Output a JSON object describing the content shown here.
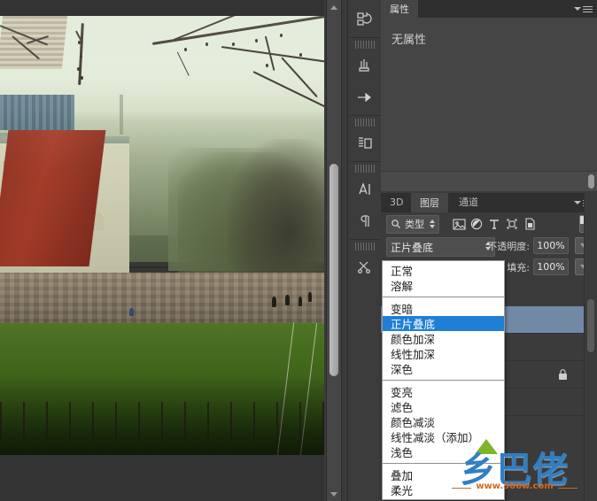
{
  "app": "Adobe Photoshop",
  "canvas": {
    "name": "document-canvas",
    "description": "Photo of a historic building with green tiled roof, bare tree branches, stone wall, stairs, green sports field and red running track"
  },
  "canvas_scrollbar": {
    "up_arrow": "scroll-up",
    "down_arrow": "scroll-down"
  },
  "tool_strip": {
    "items": [
      {
        "name": "history-actions-icon",
        "glyph": "history"
      },
      {
        "name": "brushes-icon",
        "glyph": "brush"
      },
      {
        "name": "tool-presets-icon",
        "glyph": "preset"
      },
      {
        "name": "clone-source-icon",
        "glyph": "clone"
      },
      {
        "name": "character-panel-icon",
        "glyph": "A"
      },
      {
        "name": "paragraph-panel-icon",
        "glyph": "pilcrow"
      },
      {
        "name": "adjustments-tools-icon",
        "glyph": "scissors"
      }
    ]
  },
  "properties_panel": {
    "tab_label": "属性",
    "empty_message": "无属性",
    "menu_icon": "panel-menu-icon"
  },
  "layers_panel": {
    "tabs": [
      {
        "label": "3D",
        "active": false
      },
      {
        "label": "图层",
        "active": true
      },
      {
        "label": "通道",
        "active": false
      }
    ],
    "menu_icon": "panel-menu-icon",
    "filter": {
      "search_icon": "search-icon",
      "kind_label": "类型",
      "icons": [
        {
          "name": "filter-pixel-icon"
        },
        {
          "name": "filter-adjustment-icon"
        },
        {
          "name": "filter-type-icon"
        },
        {
          "name": "filter-shape-icon"
        },
        {
          "name": "filter-smart-object-icon"
        }
      ],
      "toggle_name": "filter-enable-toggle"
    },
    "blend_mode_value": "正片叠底",
    "opacity_label": "不透明度:",
    "opacity_value": "100%",
    "fill_label": "填充:",
    "fill_value": "100%",
    "rows": [
      {
        "name": "layer-row-selected",
        "selected": true,
        "locked": false
      },
      {
        "name": "layer-row-2",
        "selected": false,
        "locked": false
      },
      {
        "name": "layer-row-background",
        "selected": false,
        "locked": true
      },
      {
        "name": "layer-row-4",
        "selected": false,
        "locked": false
      }
    ],
    "lock_icon": "lock-icon"
  },
  "blend_menu": {
    "name": "blend-mode-dropdown",
    "groups": [
      {
        "items": [
          {
            "label": "正常",
            "selected": false
          },
          {
            "label": "溶解",
            "selected": false
          }
        ]
      },
      {
        "items": [
          {
            "label": "变暗",
            "selected": false
          },
          {
            "label": "正片叠底",
            "selected": true
          },
          {
            "label": "颜色加深",
            "selected": false
          },
          {
            "label": "线性加深",
            "selected": false
          },
          {
            "label": "深色",
            "selected": false
          }
        ]
      },
      {
        "items": [
          {
            "label": "变亮",
            "selected": false
          },
          {
            "label": "滤色",
            "selected": false
          },
          {
            "label": "颜色减淡",
            "selected": false
          },
          {
            "label": "线性减淡（添加）",
            "selected": false
          },
          {
            "label": "浅色",
            "selected": false
          }
        ]
      },
      {
        "items": [
          {
            "label": "叠加",
            "selected": false
          },
          {
            "label": "柔光",
            "selected": false
          }
        ]
      }
    ]
  },
  "watermark": {
    "text": "乡巴佬",
    "url": "www.306w.com"
  },
  "colors": {
    "accent_selected": "#1f7fd4",
    "layer_selected": "#7289a5",
    "panel_bg": "#3b3b3b",
    "panel_light": "#454545",
    "tabbar_bg": "#2f2f2f",
    "menu_bg": "#ffffff",
    "watermark_blue": "#2f7fc4",
    "watermark_orange": "#d06a1e"
  }
}
